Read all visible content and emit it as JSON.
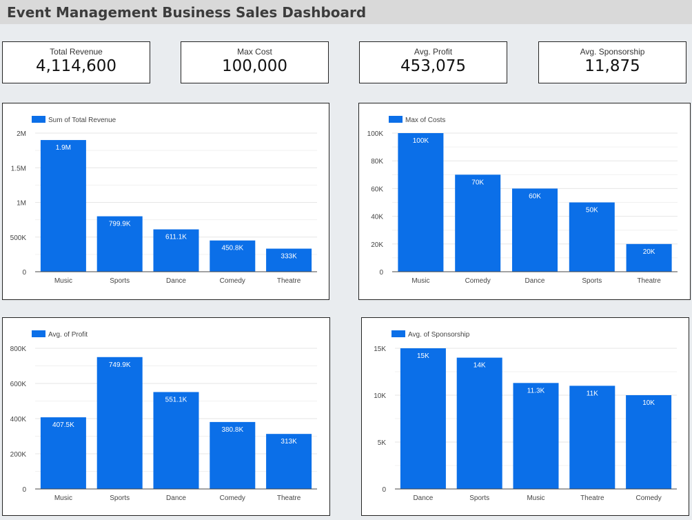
{
  "title": "Event Management Business Sales Dashboard",
  "kpis": [
    {
      "label": "Total Revenue",
      "value": "4,114,600"
    },
    {
      "label": "Max Cost",
      "value": "100,000"
    },
    {
      "label": "Avg. Profit",
      "value": "453,075"
    },
    {
      "label": "Avg. Sponsorship",
      "value": "11,875"
    }
  ],
  "colors": {
    "bar": "#0b6fe8",
    "grid": "#e6e6e6",
    "axis": "#444444"
  },
  "chart_data": [
    {
      "type": "bar",
      "legend": "Sum of Total Revenue",
      "categories": [
        "Music",
        "Sports",
        "Dance",
        "Comedy",
        "Theatre"
      ],
      "values": [
        1900000,
        799900,
        611100,
        450800,
        333000
      ],
      "data_labels": [
        "1.9M",
        "799.9K",
        "611.1K",
        "450.8K",
        "333K"
      ],
      "yticks": [
        0,
        500000,
        1000000,
        1500000,
        2000000
      ],
      "ytick_labels": [
        "0",
        "500K",
        "1M",
        "1.5M",
        "2M"
      ],
      "ylim": [
        0,
        2000000
      ]
    },
    {
      "type": "bar",
      "legend": "Max of Costs",
      "categories": [
        "Music",
        "Comedy",
        "Dance",
        "Sports",
        "Theatre"
      ],
      "values": [
        100000,
        70000,
        60000,
        50000,
        20000
      ],
      "data_labels": [
        "100K",
        "70K",
        "60K",
        "50K",
        "20K"
      ],
      "yticks": [
        0,
        20000,
        40000,
        60000,
        80000,
        100000
      ],
      "ytick_labels": [
        "0",
        "20K",
        "40K",
        "60K",
        "80K",
        "100K"
      ],
      "ylim": [
        0,
        100000
      ]
    },
    {
      "type": "bar",
      "legend": "Avg. of Profit",
      "categories": [
        "Music",
        "Sports",
        "Dance",
        "Comedy",
        "Theatre"
      ],
      "values": [
        407500,
        749900,
        551100,
        380800,
        313000
      ],
      "data_labels": [
        "407.5K",
        "749.9K",
        "551.1K",
        "380.8K",
        "313K"
      ],
      "yticks": [
        0,
        200000,
        400000,
        600000,
        800000
      ],
      "ytick_labels": [
        "0",
        "200K",
        "400K",
        "600K",
        "800K"
      ],
      "ylim": [
        0,
        800000
      ]
    },
    {
      "type": "bar",
      "legend": "Avg. of Sponsorship",
      "categories": [
        "Dance",
        "Sports",
        "Music",
        "Theatre",
        "Comedy"
      ],
      "values": [
        15000,
        14000,
        11300,
        11000,
        10000
      ],
      "data_labels": [
        "15K",
        "14K",
        "11.3K",
        "11K",
        "10K"
      ],
      "yticks": [
        0,
        5000,
        10000,
        15000
      ],
      "ytick_labels": [
        "0",
        "5K",
        "10K",
        "15K"
      ],
      "ylim": [
        0,
        15000
      ]
    }
  ]
}
